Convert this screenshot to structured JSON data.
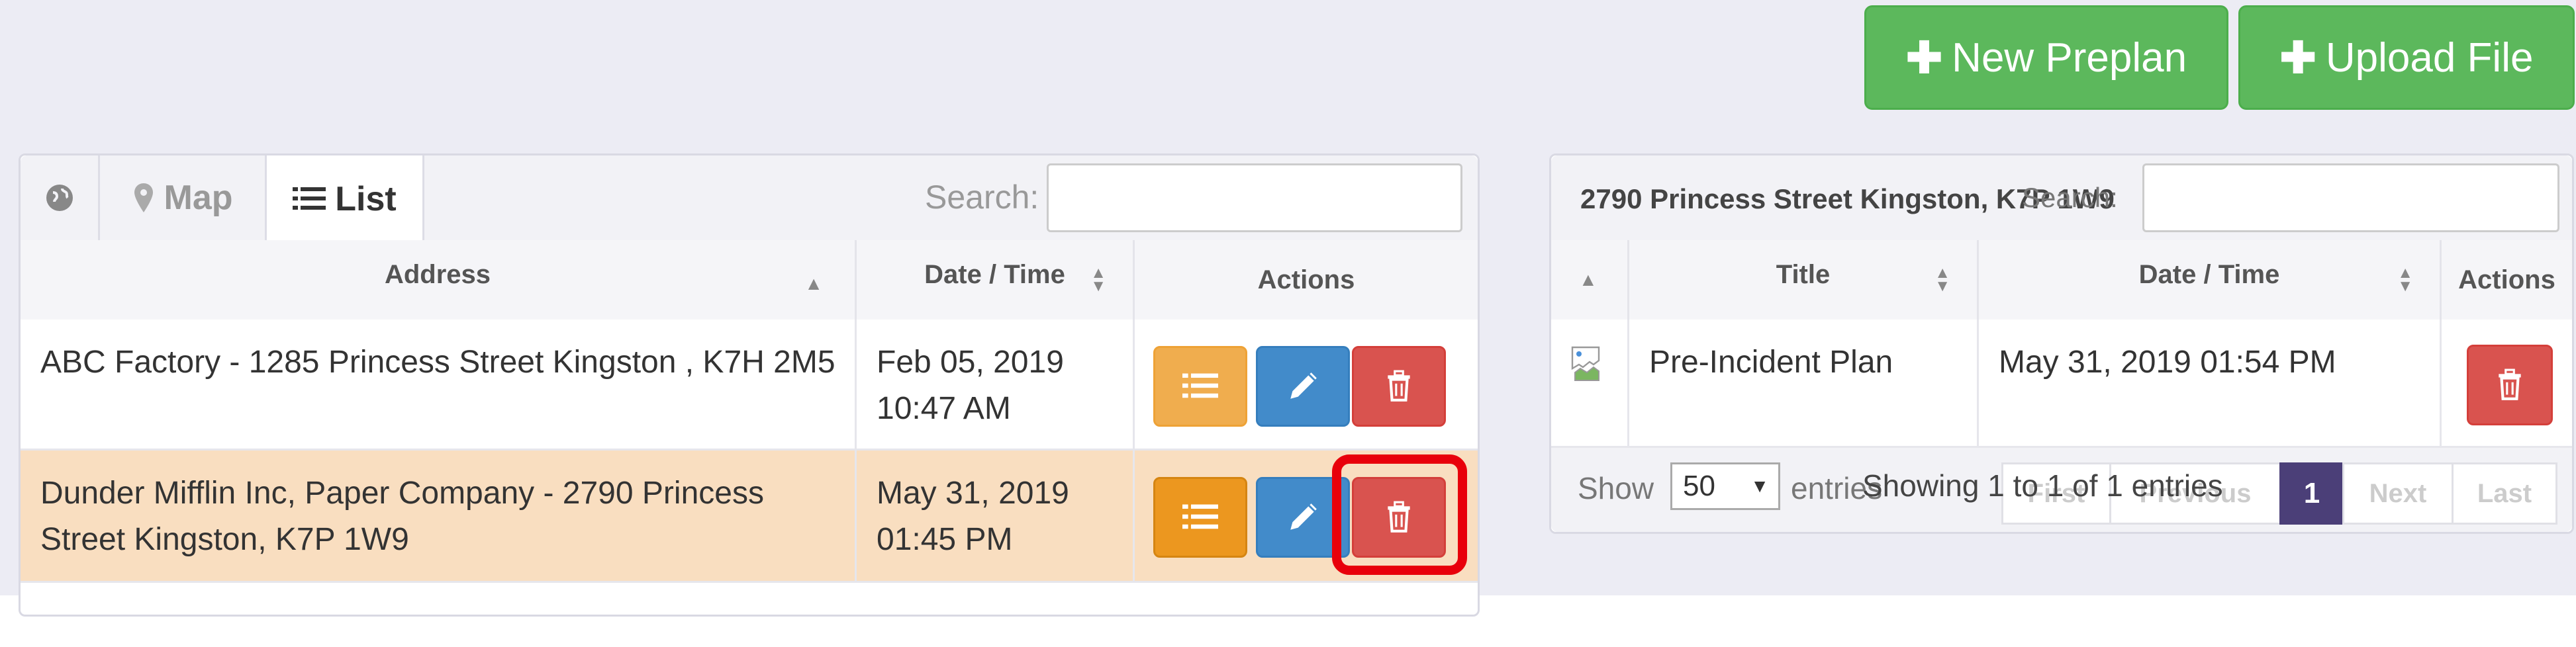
{
  "top_buttons": {
    "new_preplan": "New Preplan",
    "upload_file": "Upload File"
  },
  "left_panel": {
    "tabs": {
      "map": "Map",
      "list": "List"
    },
    "search_label": "Search:",
    "search_value": "",
    "columns": [
      "Address",
      "Date / Time",
      "Actions"
    ],
    "rows": [
      {
        "address": "ABC Factory - 1285 Princess Street Kingston , K7H 2M5",
        "date": "Feb 05, 2019",
        "time": "10:47 AM"
      },
      {
        "address": "Dunder Mifflin Inc, Paper Company - 2790 Princess Street Kingston, K7P 1W9",
        "date": "May 31, 2019",
        "time": "01:45 PM"
      }
    ]
  },
  "right_panel": {
    "header_address": "2790 Princess Street Kingston, K7P 1W9",
    "search_label": "Search:",
    "search_value": "",
    "columns": [
      "",
      "Title",
      "Date / Time",
      "Actions"
    ],
    "rows": [
      {
        "title": "Pre-Incident Plan",
        "datetime": "May 31, 2019 01:54 PM"
      }
    ],
    "footer": {
      "show_label": "Show",
      "page_size": "50",
      "entries_label": "entries",
      "info": "Showing 1 to 1 of 1 entries",
      "pagination": {
        "first": "First",
        "previous": "Previous",
        "current": "1",
        "next": "Next",
        "last": "Last"
      }
    }
  },
  "colors": {
    "success": "#5cb85c",
    "warning": "#f0ad4e",
    "primary": "#428bca",
    "danger": "#d9534f",
    "highlight_row": "#f9dec0",
    "highlight_box": "#e8000b",
    "pagination_active": "#4b3f78"
  },
  "icons": [
    "plus-icon",
    "globe-icon",
    "map-marker-icon",
    "list-icon",
    "edit-icon",
    "trash-icon",
    "sort-icon",
    "caret-down-icon",
    "broken-image-icon"
  ]
}
